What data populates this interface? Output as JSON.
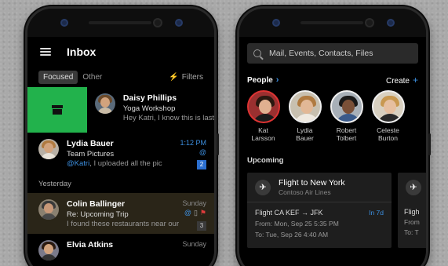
{
  "left": {
    "title": "Inbox",
    "tabs": {
      "focused": "Focused",
      "other": "Other"
    },
    "filters_label": "Filters",
    "messages": [
      {
        "sender": "Daisy Phillips",
        "subject": "Yoga Workshop",
        "preview": "Hey Katri, I know this is last"
      },
      {
        "sender": "Lydia Bauer",
        "subject": "Team Pictures",
        "mention": "@Katri",
        "preview_rest": ", I uploaded all the pic",
        "time": "1:12 PM",
        "at": "@",
        "count": "2"
      }
    ],
    "section_yesterday": "Yesterday",
    "messages_yesterday": [
      {
        "sender": "Colin Ballinger",
        "subject": "Re: Upcoming Trip",
        "preview": "I found these restaurants near our",
        "time": "Sunday",
        "count": "3"
      },
      {
        "sender": "Elvia Atkins",
        "time": "Sunday"
      }
    ]
  },
  "right": {
    "search_placeholder": "Mail, Events, Contacts, Files",
    "people_label": "People",
    "create_label": "Create",
    "people": [
      {
        "first": "Kat",
        "last": "Larsson"
      },
      {
        "first": "Lydia",
        "last": "Bauer"
      },
      {
        "first": "Robert",
        "last": "Tolbert"
      },
      {
        "first": "Celeste",
        "last": "Burton"
      }
    ],
    "upcoming_label": "Upcoming",
    "card": {
      "title": "Flight to New York",
      "subtitle": "Contoso Air Lines",
      "flight": "Flight CA KEF → JFK",
      "badge": "In 7d",
      "from": "From: Mon, Sep 25 5:35 PM",
      "to": "To: Tue, Sep 26 4:40 AM"
    },
    "peek_card": {
      "flight": "Fligh",
      "from": "From",
      "to": "To: T"
    }
  },
  "colors": {
    "accent": "#3c8fe0",
    "swipe_green": "#22b24c",
    "flag": "#e03c3c"
  }
}
